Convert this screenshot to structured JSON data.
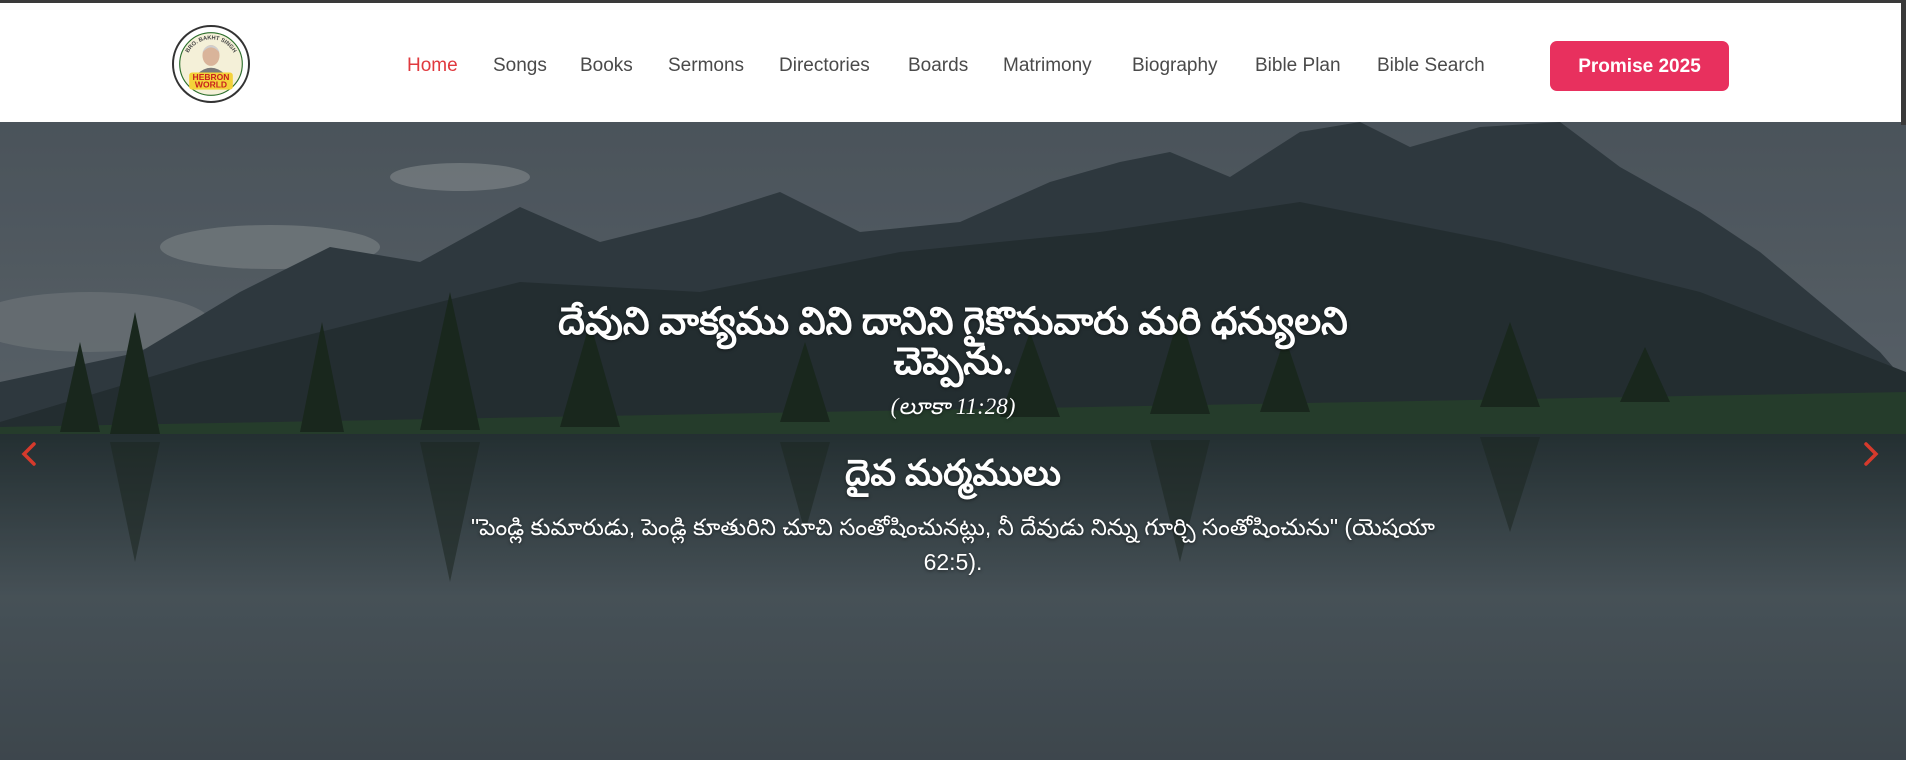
{
  "brand": {
    "logo_top_text": "BRO. BAKHT SINGH",
    "logo_main_line1": "HEBRON",
    "logo_main_line2": "WORLD"
  },
  "nav": {
    "items": [
      {
        "label": "Home",
        "active": true
      },
      {
        "label": "Songs",
        "active": false
      },
      {
        "label": "Books",
        "active": false
      },
      {
        "label": "Sermons",
        "active": false
      },
      {
        "label": "Directories",
        "active": false
      },
      {
        "label": "Boards",
        "active": false
      },
      {
        "label": "Matrimony",
        "active": false
      },
      {
        "label": "Biography",
        "active": false
      },
      {
        "label": "Bible Plan",
        "active": false
      },
      {
        "label": "Bible Search",
        "active": false
      }
    ],
    "cta_label": "Promise 2025"
  },
  "hero": {
    "verse": "దేవుని వాక్యము విని దానిని గైకొనువారు మరి ధన్యులని చెప్పెను.",
    "reference": "(లూకా 11:28)",
    "section_heading": "దైవ మర్మములు",
    "promise_text": "\"పెండ్లి కుమారుడు, పెండ్లి కూతురిని చూచి సంతోషించునట్లు, నీ దేవుడు నిన్ను గూర్చి సంతోషించును\" (యెషయా 62:5)."
  },
  "carousel": {
    "prev_icon": "chevron-left-icon",
    "next_icon": "chevron-right-icon"
  },
  "colors": {
    "accent_red": "#e0393e",
    "cta_pink": "#e8305e",
    "nav_text": "#4a4a4a",
    "arrow_red": "#d63a2c"
  }
}
